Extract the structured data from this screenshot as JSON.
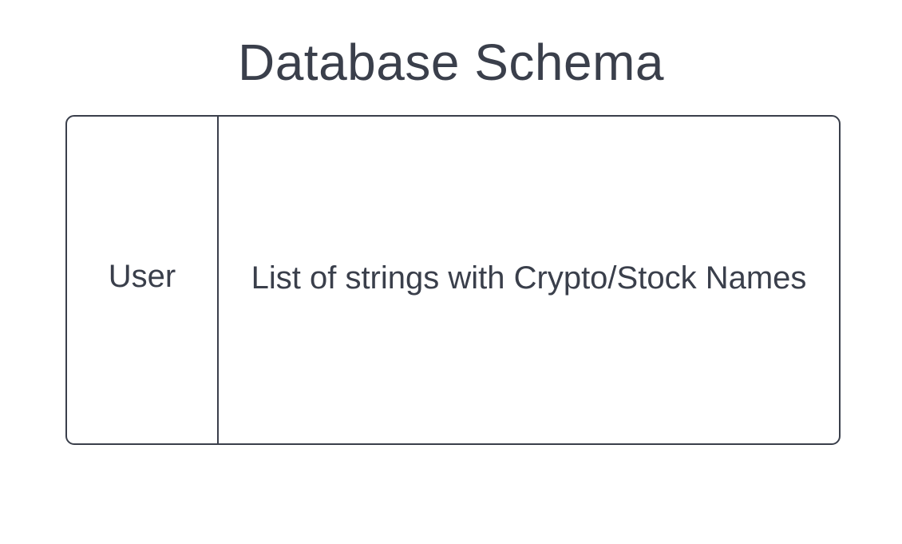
{
  "title": "Database Schema",
  "schema": {
    "columns": [
      {
        "label": "User"
      },
      {
        "label": "List of strings with Crypto/Stock Names"
      }
    ]
  },
  "colors": {
    "stroke": "#3a3f4b",
    "text": "#3a3f4b",
    "background": "#ffffff"
  }
}
